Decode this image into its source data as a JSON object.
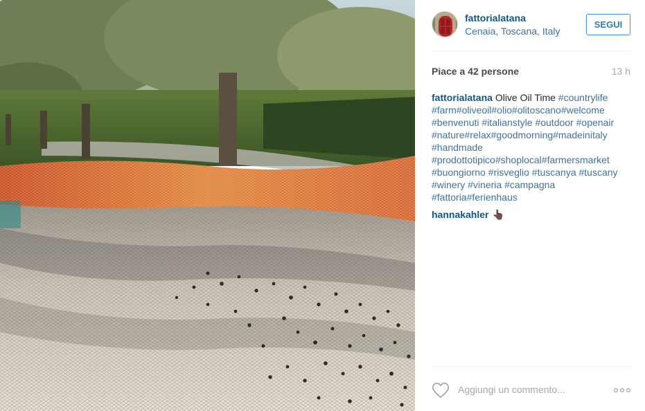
{
  "post": {
    "photo_icon": "olive-harvest-photo",
    "author": {
      "username": "fattorialatana",
      "location": "Cenaia, Toscana, Italy",
      "avatar_icon": "red-door-avatar"
    },
    "follow_label": "SEGUI",
    "likes_text": "Piace a 42 persone",
    "time_ago": "13 h",
    "caption": {
      "author": "fattorialatana",
      "text": "Olive Oil Time",
      "tags": [
        "#countrylife",
        "#farm",
        "#oliveoil",
        "#olio",
        "#olitoscano",
        "#welcome",
        "#benvenuti",
        "#italianstyle",
        "#outdoor",
        "#openair",
        "#nature",
        "#relax",
        "#goodmorning",
        "#madeinitaly",
        "#handmade",
        "#prodottotipico",
        "#shoplocal",
        "#farmersmarket",
        "#buongiorno",
        "#risveglio",
        "#tuscanya",
        "#tuscany",
        "#winery",
        "#vineria",
        "#campagna",
        "#fattoria",
        "#ferienhaus"
      ]
    },
    "comments": [
      {
        "author": "hannakahler",
        "text": "👆🏿"
      }
    ],
    "add_comment_placeholder": "Aggiungi un commento...",
    "like_icon": "heart-outline-icon",
    "more_icon": "more-options-icon"
  },
  "colors": {
    "link": "#125688",
    "tag": "#3f729b",
    "follow_border": "#4090db",
    "muted": "#a5a7aa"
  }
}
